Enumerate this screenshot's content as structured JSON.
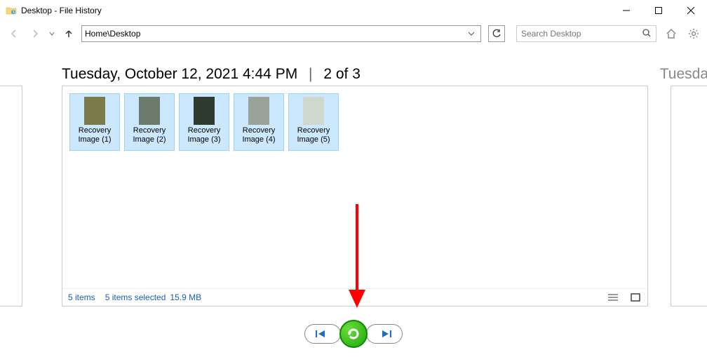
{
  "titlebar": {
    "title": "Desktop - File History"
  },
  "nav": {
    "path": "Home\\Desktop"
  },
  "search": {
    "placeholder": "Search Desktop"
  },
  "header": {
    "date_label": "Tuesday, October 12, 2021 4:44 PM",
    "position": "2 of 3",
    "next_peek": "Tuesda"
  },
  "thumbs": [
    {
      "label": "Recovery Image (1)",
      "bg": "#7a7a4a"
    },
    {
      "label": "Recovery Image (2)",
      "bg": "#6b7a6b"
    },
    {
      "label": "Recovery Image (3)",
      "bg": "#2f3b2f"
    },
    {
      "label": "Recovery Image (4)",
      "bg": "#9aa399"
    },
    {
      "label": "Recovery Image (5)",
      "bg": "#cfd8cc"
    }
  ],
  "status": {
    "items": "5 items",
    "selected": "5 items selected",
    "size": "15.9 MB"
  }
}
